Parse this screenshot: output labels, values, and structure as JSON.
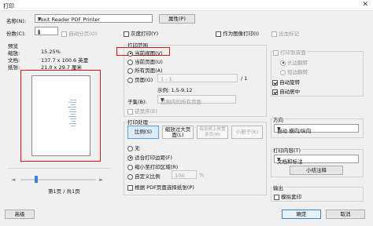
{
  "window": {
    "title": "打印",
    "close_glyph": "✕"
  },
  "printer": {
    "name_label": "名称(N):",
    "selected": "Foxit Reader PDF Printer",
    "properties_button": "属性(P)",
    "copies_label": "份数(C):",
    "copies_value": "1",
    "collate_label": "自动分页(O)",
    "grayscale_label": "灰度打印(Y)",
    "print_as_image_label": "作为图像打印(I)",
    "output_marks_label": "出血标记"
  },
  "preview": {
    "title": "预览",
    "zoom_label": "缩放:",
    "zoom_value": "15.25%",
    "doc_label": "文档:",
    "doc_value": "137.7 x 100.6 英里",
    "paper_label": "纸张:",
    "paper_value": "21.0 x 29.7 厘米",
    "page_indicator": "第1页 / 共1页",
    "prev_glyph": "◄",
    "next_glyph": "►"
  },
  "print_range": {
    "title": "打印范围",
    "current_view": "当前视图(V)",
    "current_page": "当前页面(U)",
    "all_pages": "所有页面(A)",
    "pages": "页面(G)",
    "pages_value": "1 - 1",
    "pages_total": "/ 1",
    "example": "示例: 1,5-9,12",
    "subset_label": "子集(B):",
    "subset_value": "范围内的所有页面",
    "reverse_label": "逆页序(E)",
    "selected_option": "current_view"
  },
  "print_handling": {
    "title": "打印处理",
    "tiles": [
      "比例(S)",
      "缩放过大页面(L)",
      "每张纸上放置多页(M)",
      "小册子(K)"
    ],
    "none": "无",
    "fit": "适合打印边距(F)",
    "shrink": "缩小至打印区域(R)",
    "custom": "自定义比例",
    "custom_value": "100",
    "custom_unit": "%",
    "pdf_paper_source": "根据 PDF页面选择纸张(P)",
    "selected_option": "fit"
  },
  "right": {
    "double_sided_label": "打印到双面",
    "long_edge": "长边翻转",
    "short_edge": "短边翻转",
    "auto_rotate": "自动旋转",
    "auto_center": "自动居中",
    "orientation_title": "方向",
    "orientation_value": "自动 横向/纵向",
    "content_title": "打印内容(T)",
    "content_value": "文档和标注",
    "summary_button": "小结注释",
    "output_title": "输出",
    "simulate_overprint": "模拟套印"
  },
  "footer": {
    "advanced_button": "高级",
    "ok_button": "确定",
    "cancel_button": "取消"
  },
  "colors": {
    "highlight": "#e01010",
    "accent": "#3c7fd8"
  }
}
